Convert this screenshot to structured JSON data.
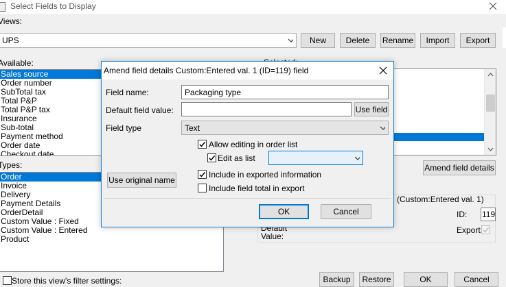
{
  "main": {
    "title": "Select Fields to Display",
    "views_label": "Views:",
    "view_value": "UPS",
    "buttons": {
      "new": "New",
      "delete": "Delete",
      "rename": "Rename",
      "import": "Import",
      "export": "Export"
    },
    "available_label": "Available:",
    "available_items": [
      "Sales source",
      "Order number",
      "SubTotal tax",
      "Total P&P",
      "Total P&P tax",
      "Insurance",
      "Sub-total",
      "Payment method",
      "Order date",
      "Checkout date"
    ],
    "selected_label": "Selected:",
    "types_label": "Types:",
    "types_items": [
      "Order",
      "Invoice",
      "Delivery",
      "Payment Details",
      "OrderDetail",
      "Custom Value : Fixed",
      "Custom Value : Entered",
      "Product"
    ],
    "amend_button": "Amend field details",
    "field_info_text": "de etc) (Custom:Entered val. 1)",
    "id_label": "ID:",
    "id_value": "119",
    "default_label": "Default\nValue:",
    "export_label": "Export:",
    "store_filter_label": "Store this view's filter settings:",
    "backup": "Backup",
    "restore": "Restore",
    "ok": "OK",
    "cancel": "Cancel"
  },
  "dialog": {
    "title": "Amend field details Custom:Entered val. 1 (ID=119) field",
    "field_name_label": "Field name:",
    "field_name_value": "Packaging type",
    "default_value_label": "Default field value:",
    "default_value_value": "",
    "use_field": "Use field",
    "field_type_label": "Field type",
    "field_type_value": "Text",
    "allow_editing": "Allow editing in order list",
    "edit_as_list": "Edit as list",
    "include_exported": "Include in exported information",
    "include_total": "Include field total in export",
    "use_original": "Use original name",
    "ok": "OK",
    "cancel": "Cancel"
  },
  "colors": {
    "selection": "#0078d7",
    "window_bg": "#f0f0f0"
  }
}
